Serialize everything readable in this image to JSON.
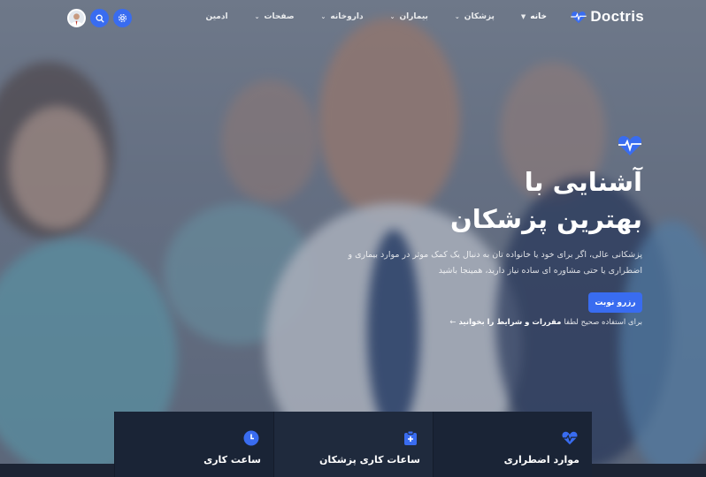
{
  "brand": {
    "name": "Doctris",
    "accent": "#396cf0"
  },
  "nav": {
    "items": [
      {
        "label": "خانه",
        "active": true,
        "has_dropdown": true
      },
      {
        "label": "پزشکان",
        "active": false,
        "has_dropdown": true
      },
      {
        "label": "بیماران",
        "active": false,
        "has_dropdown": true
      },
      {
        "label": "داروخانه",
        "active": false,
        "has_dropdown": true
      },
      {
        "label": "صفحات",
        "active": false,
        "has_dropdown": true
      },
      {
        "label": "ادمین",
        "active": false,
        "has_dropdown": false
      }
    ]
  },
  "header_actions": [
    {
      "icon": "settings-icon"
    },
    {
      "icon": "search-icon"
    },
    {
      "icon": "avatar"
    }
  ],
  "hero": {
    "title_line1": "آشنایی با",
    "title_line2": "بهترین پزشکان",
    "description": "پزشکانی عالی، اگر برای خود یا خانواده تان به دنبال یک کمک موثر در موارد بیماری و اضطراری یا حتی مشاوره ای ساده نیاز دارید، همینجا باشید",
    "cta_label": "رزرو نوبت",
    "terms_prefix": "برای استفاده صحیح لطفا",
    "terms_link": "مقررات و شرایط را بخوانید",
    "terms_arrow": "←"
  },
  "cards": [
    {
      "title": "موارد اضطراری",
      "icon": "heartbeat-icon"
    },
    {
      "title": "ساعات کاری پزشکان",
      "icon": "medical-kit-icon"
    },
    {
      "title": "ساعت کاری",
      "icon": "clock-icon"
    }
  ]
}
